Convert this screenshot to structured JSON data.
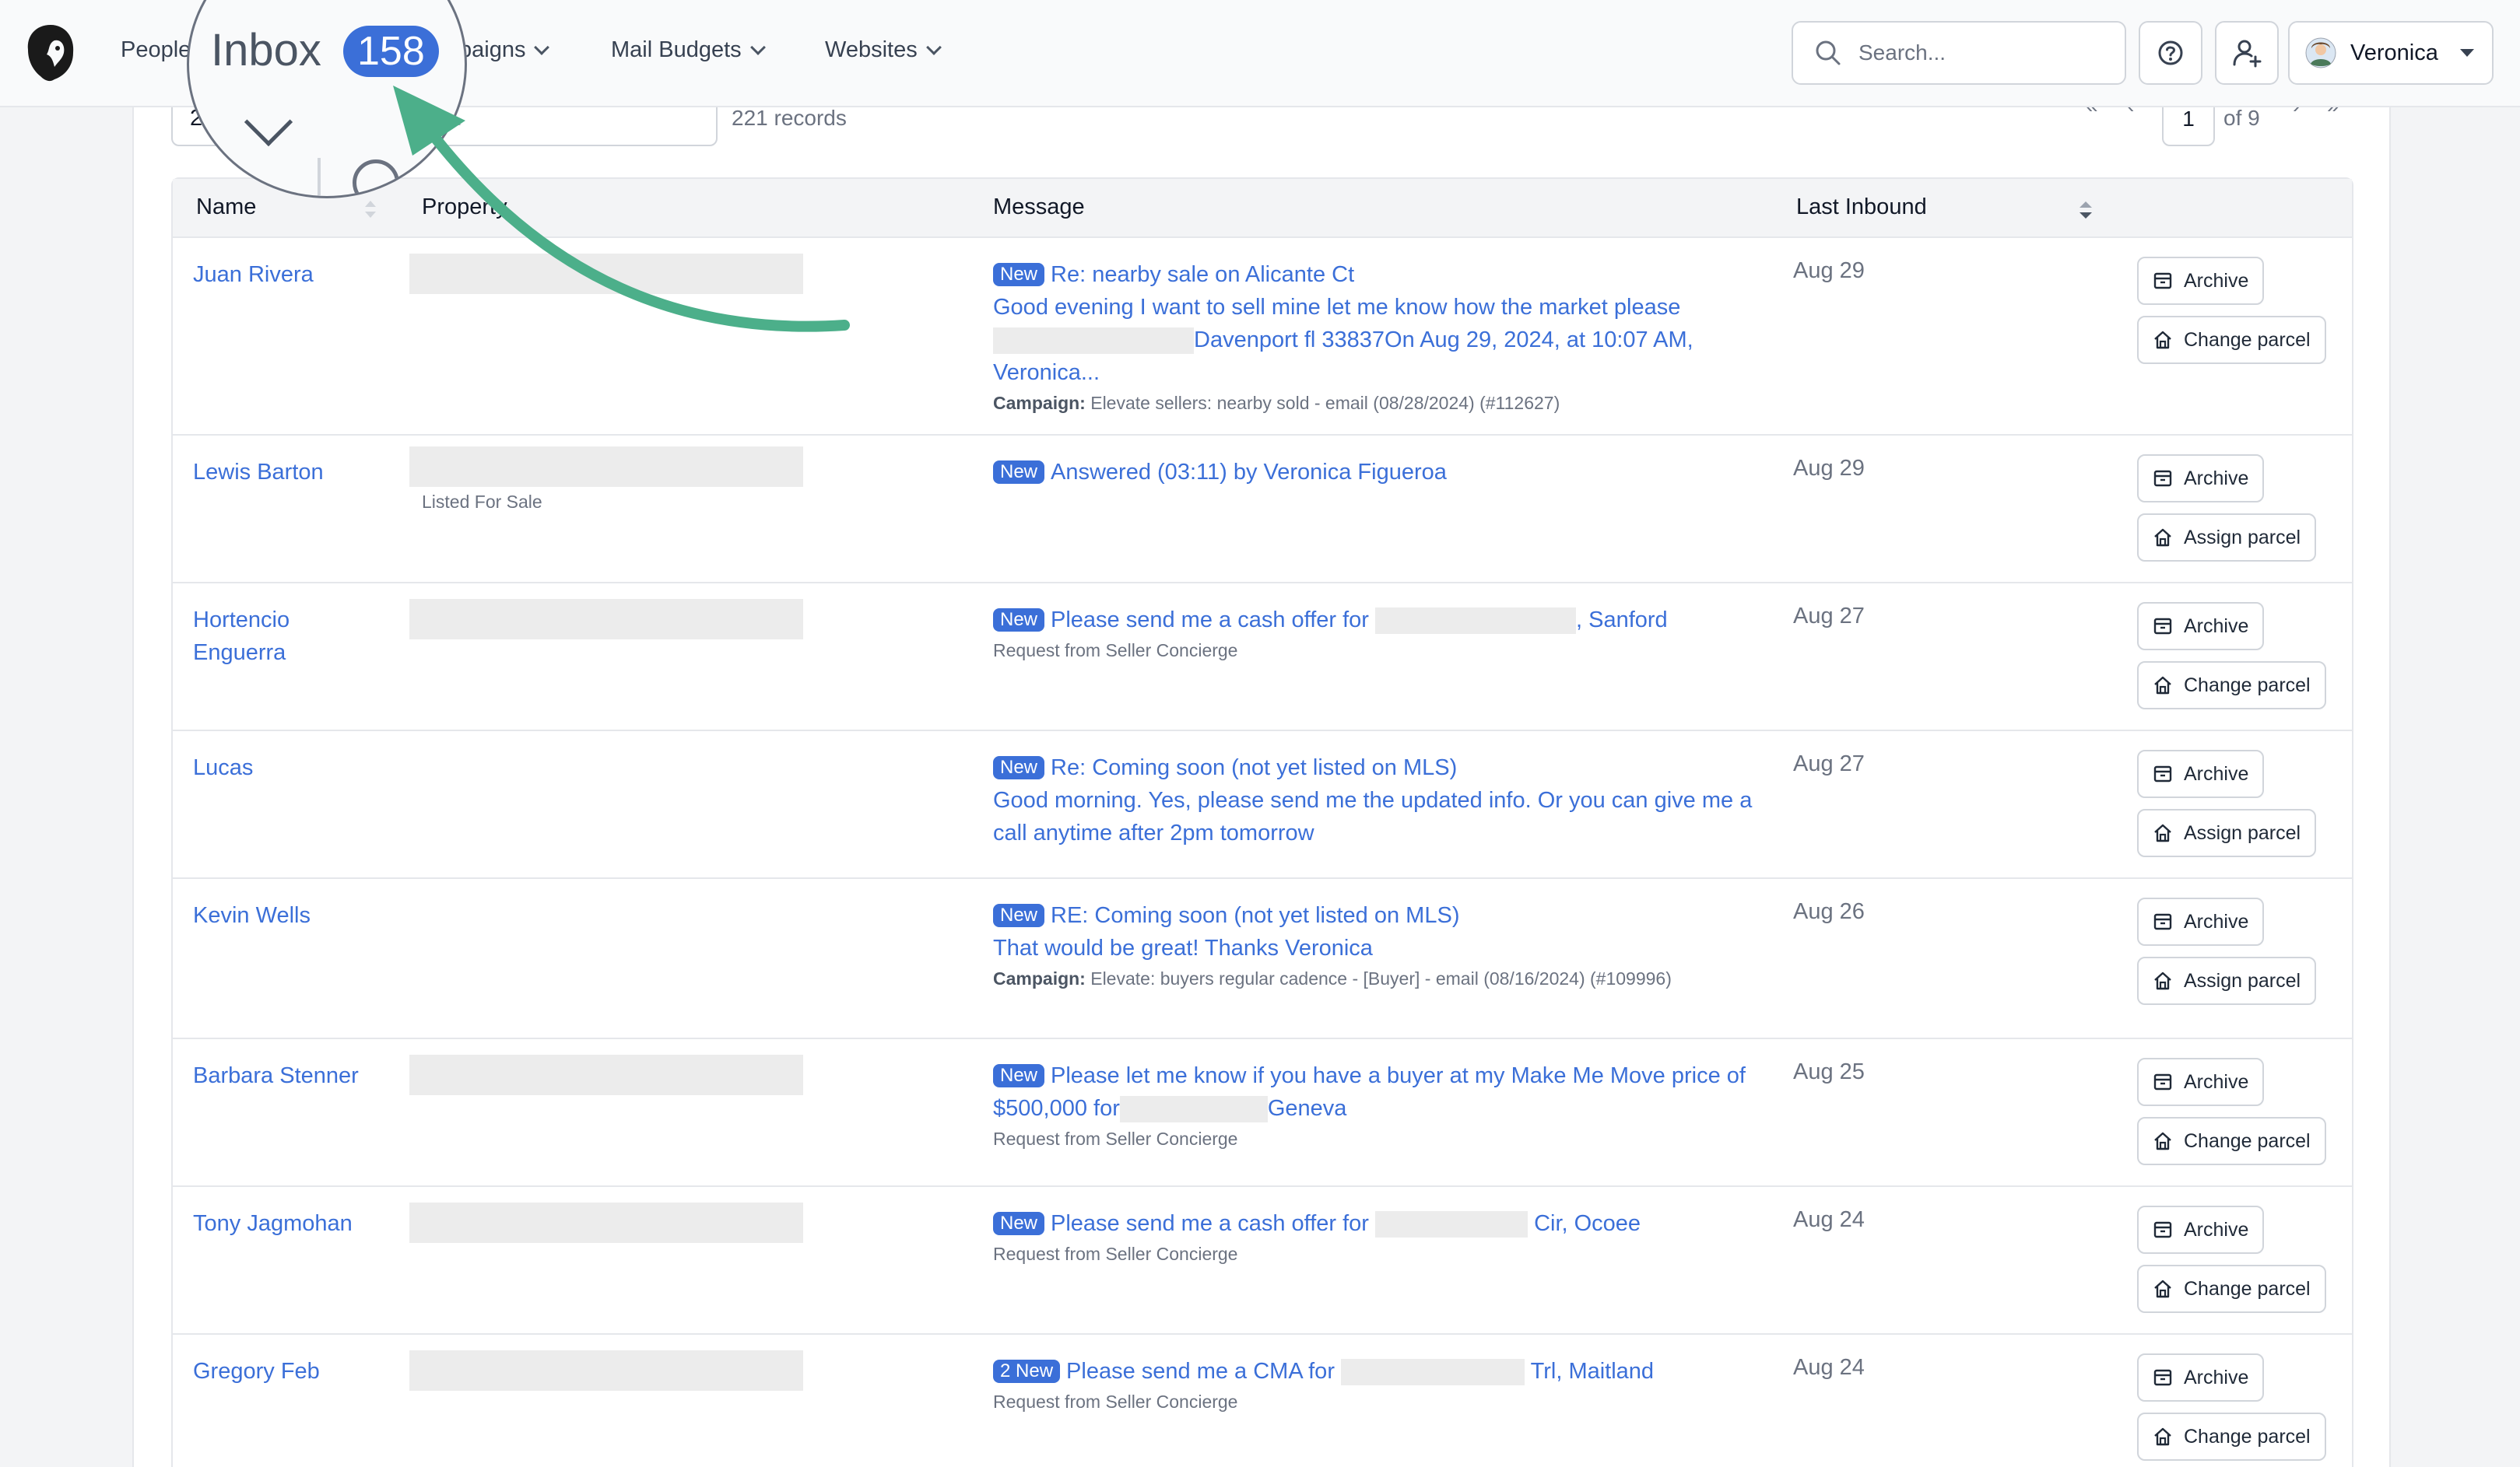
{
  "nav": {
    "items": [
      {
        "label": "People"
      },
      {
        "label": "paigns"
      },
      {
        "label": "Mail Budgets"
      },
      {
        "label": "Websites"
      }
    ],
    "search_placeholder": "Search...",
    "user_name": "Veronica"
  },
  "magnifier": {
    "title": "Inbox",
    "count": "158"
  },
  "toolbar": {
    "filter_partial": "2",
    "filter_placeholder": "...",
    "records": "221 records",
    "page": "1",
    "of_pages": "of 9"
  },
  "table": {
    "headers": {
      "name": "Name",
      "property": "Property",
      "message": "Message",
      "last_inbound": "Last Inbound"
    },
    "rows": [
      {
        "name": "Juan Rivera",
        "badge": "New",
        "subject": "Re: nearby sale on Alicante Ct",
        "body_a": "Good evening I want to sell mine let me know how the market please",
        "body_b": "Davenport fl 33837On Aug 29, 2024, at 10:07 AM, Veronica...",
        "meta_label": "Campaign:",
        "meta": "Elevate sellers: nearby sold - email (08/28/2024) (#112627)",
        "date": "Aug 29",
        "actions": [
          "Archive",
          "Change parcel"
        ]
      },
      {
        "name": "Lewis Barton",
        "property_sub": "Listed For Sale",
        "badge": "New",
        "subject": "Answered (03:11) by Veronica Figueroa",
        "date": "Aug 29",
        "actions": [
          "Archive",
          "Assign parcel"
        ]
      },
      {
        "name": "Hortencio Enguerra",
        "badge": "New",
        "subject_a": "Please send me a cash offer for",
        "subject_b": ", Sanford",
        "sub": "Request from Seller Concierge",
        "date": "Aug 27",
        "actions": [
          "Archive",
          "Change parcel"
        ]
      },
      {
        "name": "Lucas",
        "badge": "New",
        "subject": "Re: Coming soon (not yet listed on MLS)",
        "body": "Good morning. Yes, please send me the updated info. Or you can give me a call anytime after 2pm tomorrow",
        "date": "Aug 27",
        "actions": [
          "Archive",
          "Assign parcel"
        ]
      },
      {
        "name": "Kevin Wells",
        "badge": "New",
        "subject": "RE: Coming soon (not yet listed on MLS)",
        "body": "That would be great! Thanks Veronica",
        "meta_label": "Campaign:",
        "meta": "Elevate: buyers regular cadence - [Buyer] - email (08/16/2024) (#109996)",
        "date": "Aug 26",
        "actions": [
          "Archive",
          "Assign parcel"
        ]
      },
      {
        "name": "Barbara Stenner",
        "badge": "New",
        "subject_a": "Please let me know if you have a buyer at my Make Me Move price of $500,000 for",
        "subject_b": "Geneva",
        "sub": "Request from Seller Concierge",
        "date": "Aug 25",
        "actions": [
          "Archive",
          "Change parcel"
        ]
      },
      {
        "name": "Tony Jagmohan",
        "badge": "New",
        "subject_a": "Please send me a cash offer for",
        "subject_b": "Cir, Ocoee",
        "sub": "Request from Seller Concierge",
        "date": "Aug 24",
        "actions": [
          "Archive",
          "Change parcel"
        ]
      },
      {
        "name": "Gregory Feb",
        "badge": "2 New",
        "subject_a": "Please send me a CMA for",
        "subject_b": "Trl, Maitland",
        "sub": "Request from Seller Concierge",
        "date": "Aug 24",
        "actions": [
          "Archive",
          "Change parcel"
        ]
      }
    ]
  },
  "colors": {
    "link": "#3b6fd8",
    "badge": "#3b6fd8",
    "arrow": "#4caf8a"
  }
}
